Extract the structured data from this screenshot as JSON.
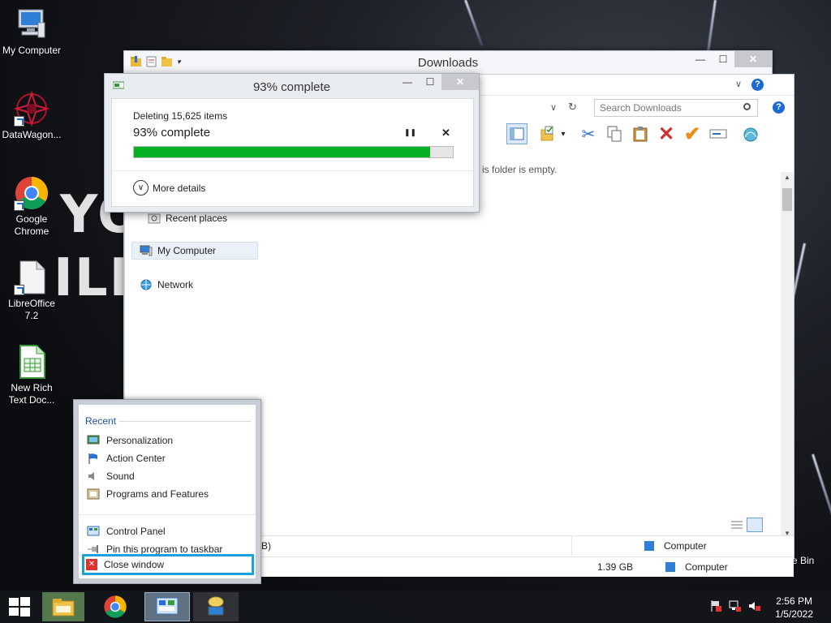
{
  "desktop": {
    "icons": [
      {
        "label": "My Computer"
      },
      {
        "label": "DataWagon..."
      },
      {
        "label": "Google Chrome"
      },
      {
        "label": "LibreOffice 7.2"
      },
      {
        "label": "New Rich Text Doc..."
      }
    ],
    "recycle_bin": "Recycle Bin",
    "bg_text_1": "YO",
    "bg_text_2": "ILL"
  },
  "explorer": {
    "title": "Downloads",
    "search_placeholder": "Search Downloads",
    "empty_text": "is folder is empty.",
    "nav": {
      "recent_places": "Recent places",
      "my_computer": "My Computer",
      "network": "Network"
    },
    "status": {
      "row1_left": "B)",
      "row1_right": "Computer",
      "row2_size": "1.39 GB",
      "row2_right": "Computer"
    },
    "help": "?"
  },
  "progress_dialog": {
    "title": "93% complete",
    "deleting": "Deleting 15,625 items",
    "percent_text": "93% complete",
    "percent": 93,
    "more_details": "More details",
    "pause": "❚❚",
    "cancel": "✕"
  },
  "jumplist": {
    "recent_header": "Recent",
    "recent": [
      {
        "label": "Personalization"
      },
      {
        "label": "Action Center"
      },
      {
        "label": "Sound"
      },
      {
        "label": "Programs and Features"
      }
    ],
    "tasks": [
      {
        "label": "Control Panel"
      },
      {
        "label": "Pin this program to taskbar"
      },
      {
        "label": "Close window"
      }
    ]
  },
  "taskbar": {
    "time": "2:56 PM",
    "date": "1/5/2022"
  },
  "colors": {
    "progress_fill": "#06b025",
    "highlight": "#1ba1e2",
    "close_button": "#c7c9cc"
  }
}
